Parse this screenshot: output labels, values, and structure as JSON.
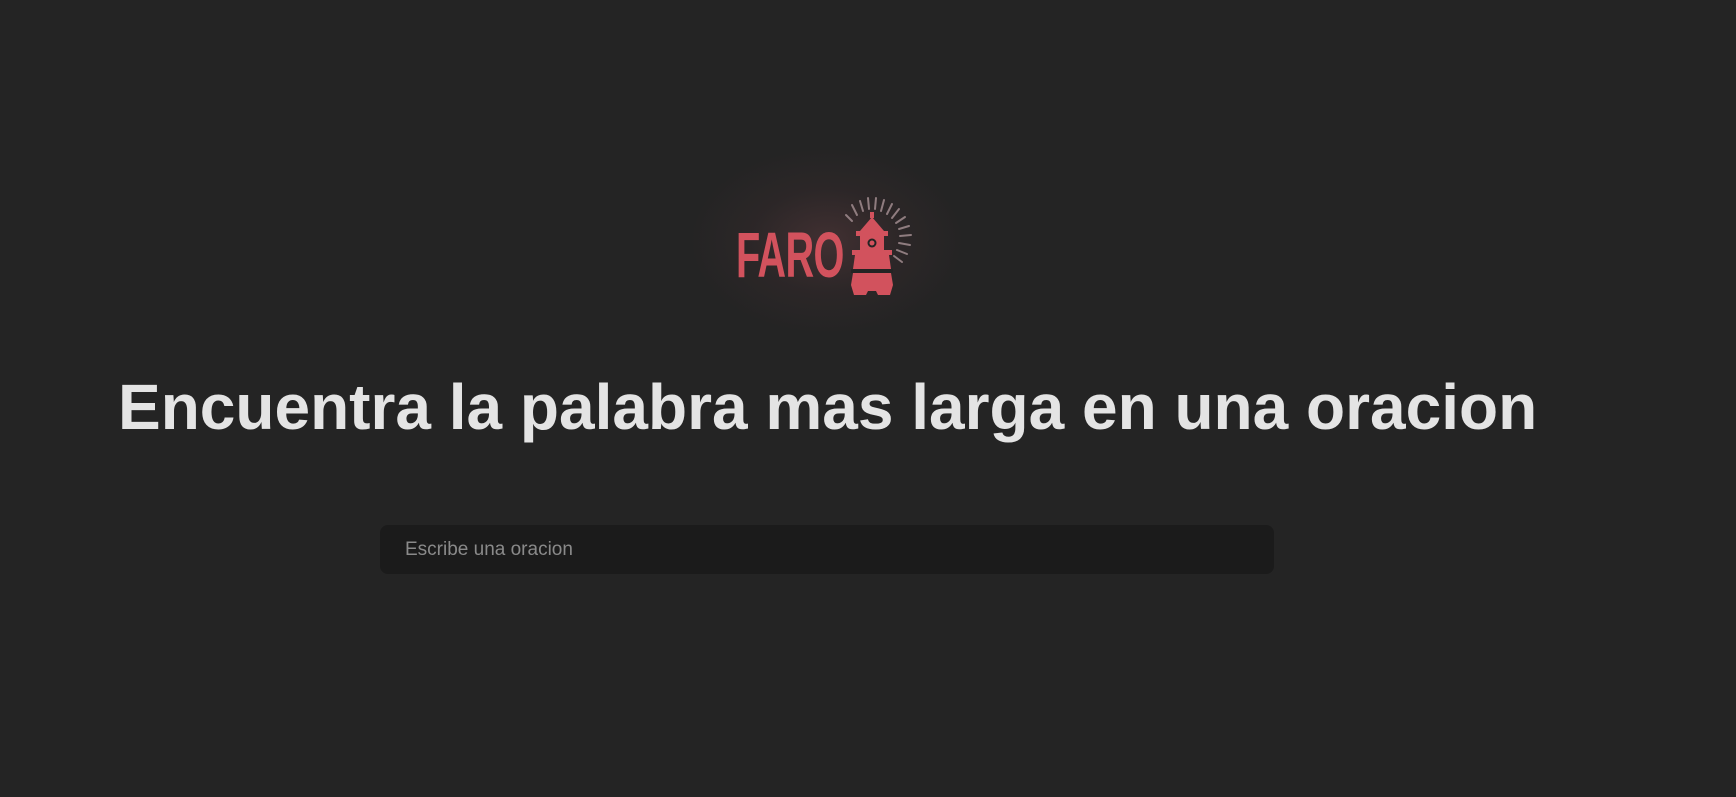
{
  "brand": {
    "name": "FARO",
    "color": "#d2525d",
    "icon": "lighthouse-icon"
  },
  "main": {
    "title": "Encuentra la palabra mas larga en una oracion",
    "sentence_input": {
      "value": "",
      "placeholder": "Escribe una oracion"
    }
  },
  "colors": {
    "background": "#242424",
    "title_text": "#e4e4e4",
    "input_background": "#1b1b1b",
    "placeholder_text": "#8a8a8a"
  }
}
